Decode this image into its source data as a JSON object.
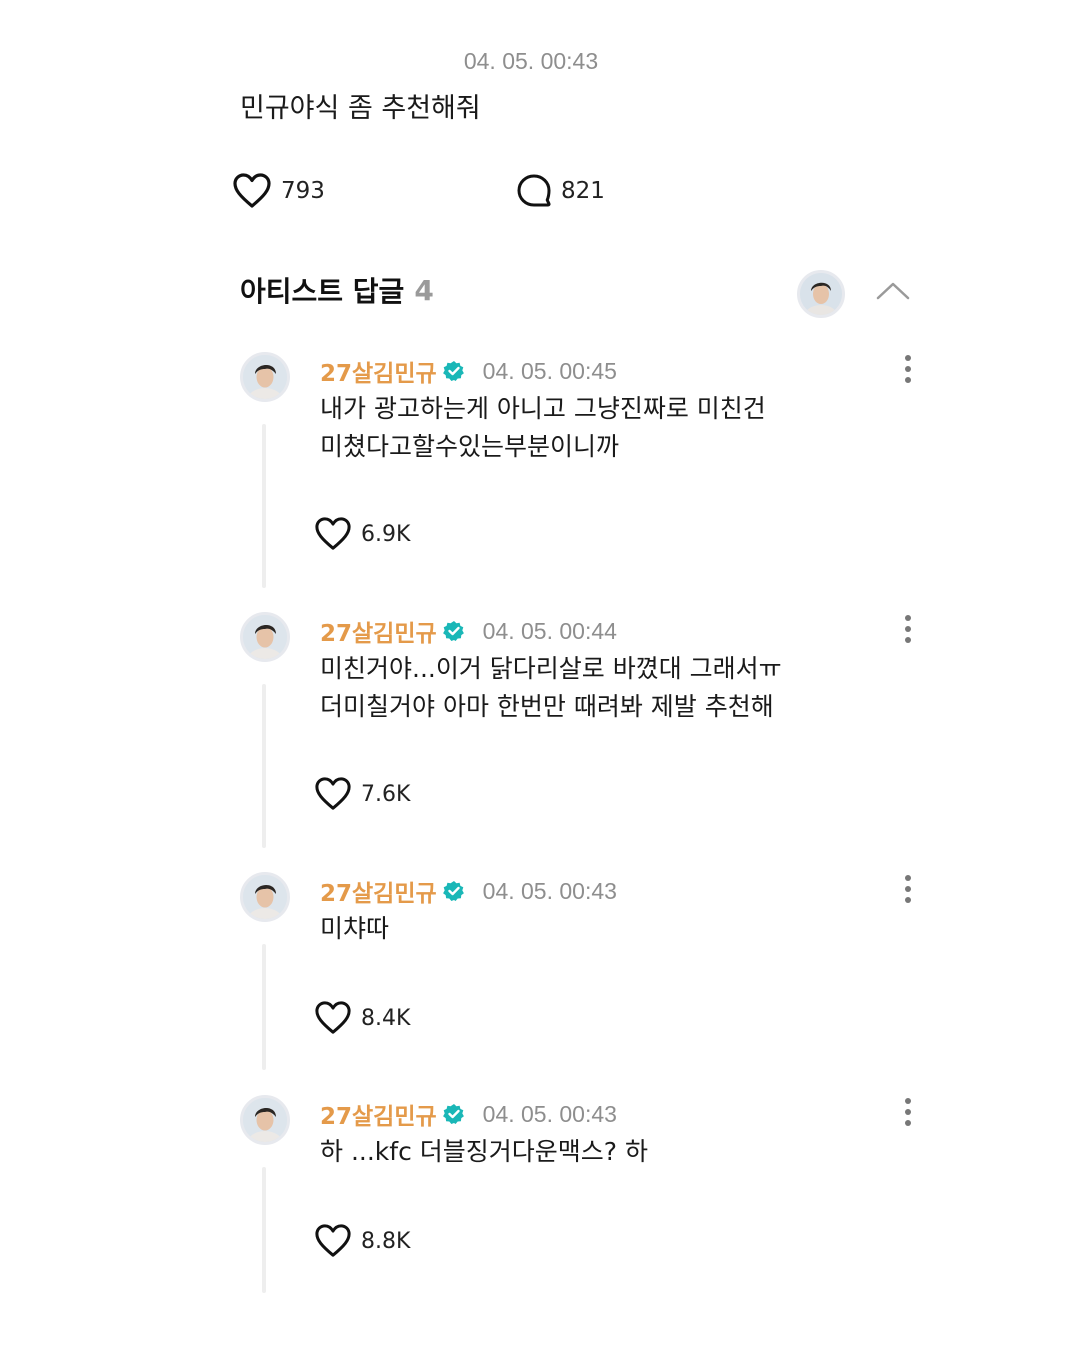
{
  "post": {
    "timestamp": "04. 05. 00:43",
    "text": "민규야식 좀 추천해줘",
    "likes": "793",
    "comments": "821"
  },
  "section": {
    "title": "아티스트 답글",
    "count": "4"
  },
  "icons": {
    "like": "heart-outline-icon",
    "comment": "speech-bubble-icon",
    "verified": "verified-badge-icon",
    "more": "vertical-ellipsis-icon",
    "collapse": "chevron-up-icon"
  },
  "colors": {
    "artist_name": "#e49a4a",
    "verified_badge": "#1ab7b7",
    "timestamp": "#8e8e8e"
  },
  "replies": [
    {
      "author": "27살김민규",
      "timestamp": "04. 05. 00:45",
      "lines": [
        "내가 광고하는게 아니고 그냥진짜로 미친건",
        "미쳤다고할수있는부분이니까"
      ],
      "likes": "6.9K"
    },
    {
      "author": "27살김민규",
      "timestamp": "04. 05. 00:44",
      "lines": [
        "미친거야...이거  닭다리살로 바꼈대 그래서ㅠ",
        "더미칠거야 아마 한번만 때려봐 제발 추천해"
      ],
      "likes": "7.6K"
    },
    {
      "author": "27살김민규",
      "timestamp": "04. 05. 00:43",
      "lines": [
        "미챠따"
      ],
      "likes": "8.4K"
    },
    {
      "author": "27살김민규",
      "timestamp": "04. 05. 00:43",
      "lines": [
        "하 ...kfc 더블징거다운맥스? 하"
      ],
      "likes": "8.8K"
    }
  ]
}
